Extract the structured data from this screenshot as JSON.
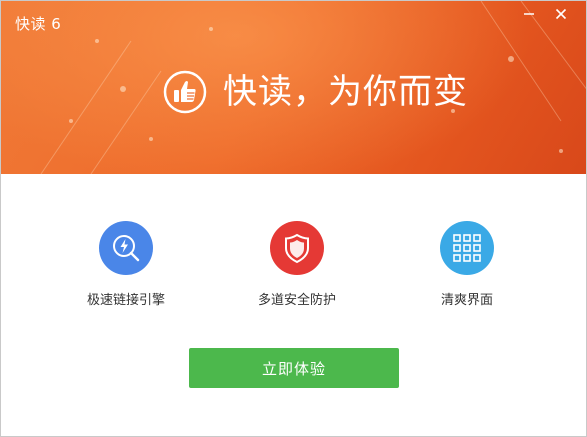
{
  "window": {
    "title": "快读 6",
    "controls": {
      "minimize_icon": "minimize-icon",
      "close_icon": "close-icon"
    }
  },
  "banner": {
    "slogan": "快读，为你而变",
    "logo_icon": "thumbs-up-icon",
    "colors": {
      "start": "#f07a37",
      "end": "#d8481a"
    }
  },
  "features": [
    {
      "label": "极速链接引擎",
      "icon": "lightning-search-icon",
      "color": "#4a86e8"
    },
    {
      "label": "多道安全防护",
      "icon": "shield-icon",
      "color": "#e53935"
    },
    {
      "label": "清爽界面",
      "icon": "grid-icon",
      "color": "#3aa9e6"
    }
  ],
  "cta": {
    "label": "立即体验",
    "color": "#4cb84c"
  }
}
